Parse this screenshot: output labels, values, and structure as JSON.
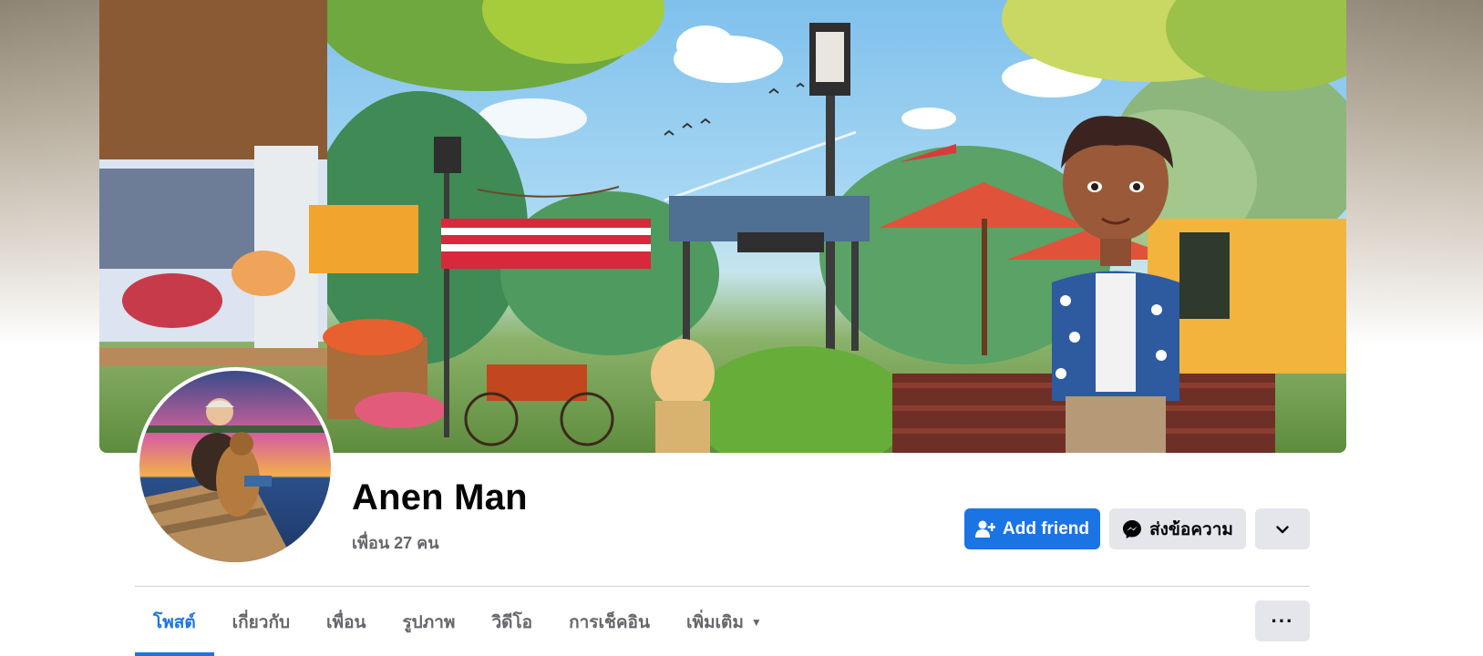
{
  "profile": {
    "name": "Anen Man",
    "friends_label": "เพื่อน 27 คน"
  },
  "actions": {
    "add_friend_label": "Add friend",
    "message_label": "ส่งข้อความ",
    "expand_icon": "chevron-down-icon",
    "add_friend_icon": "person-add-icon",
    "message_icon": "messenger-icon"
  },
  "tabs": [
    {
      "label": "โพสต์",
      "active": true
    },
    {
      "label": "เกี่ยวกับ",
      "active": false
    },
    {
      "label": "เพื่อน",
      "active": false
    },
    {
      "label": "รูปภาพ",
      "active": false
    },
    {
      "label": "วิดีโอ",
      "active": false
    },
    {
      "label": "การเช็คอิน",
      "active": false
    },
    {
      "label": "เพิ่มเติม",
      "active": false
    }
  ],
  "more_tab_caret": "▼",
  "tab_overflow_label": "···",
  "colors": {
    "accent": "#1b74e4",
    "secondary_button": "#e4e6eb",
    "secondary_text": "#65676b"
  }
}
